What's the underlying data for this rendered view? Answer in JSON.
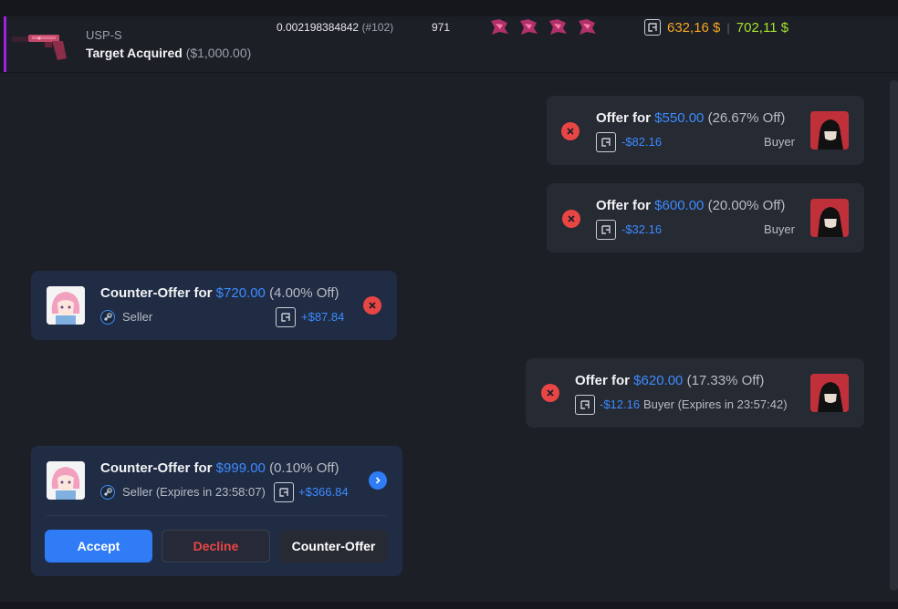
{
  "item": {
    "name": "USP-S",
    "skin": "Target Acquired",
    "price": "($1,000.00)",
    "float": "0.002198384842",
    "float_rank": "(#102)",
    "pattern": "971",
    "sticker_count": 4,
    "price_primary": "632,16 $",
    "price_separator": "|",
    "price_secondary": "702,11 $"
  },
  "offers": [
    {
      "side": "buyer",
      "title_prefix": "Offer for ",
      "amount": "$550.00",
      "discount": " (26.67% Off)",
      "diff": "-$82.16",
      "role": "Buyer"
    },
    {
      "side": "buyer",
      "title_prefix": "Offer for ",
      "amount": "$600.00",
      "discount": " (20.00% Off)",
      "diff": "-$32.16",
      "role": "Buyer"
    },
    {
      "side": "seller",
      "title_prefix": "Counter-Offer for ",
      "amount": "$720.00",
      "discount": " (4.00% Off)",
      "diff": "+$87.84",
      "role": "Seller"
    },
    {
      "side": "buyer",
      "title_prefix": "Offer for ",
      "amount": "$620.00",
      "discount": " (17.33% Off)",
      "diff": "-$12.16",
      "role": "Buyer (Expires in 23:57:42)"
    },
    {
      "side": "seller",
      "title_prefix": "Counter-Offer for ",
      "amount": "$999.00",
      "discount": " (0.10% Off)",
      "diff": "+$366.84",
      "role": "Seller (Expires in 23:58:07)"
    }
  ],
  "actions": {
    "accept": "Accept",
    "decline": "Decline",
    "counter": "Counter-Offer"
  },
  "colors": {
    "accent_blue": "#3d8bff",
    "danger_red": "#e84545",
    "price_orange": "#f5a623",
    "price_green": "#a6e22e",
    "rarity_purple": "#a020e0"
  }
}
